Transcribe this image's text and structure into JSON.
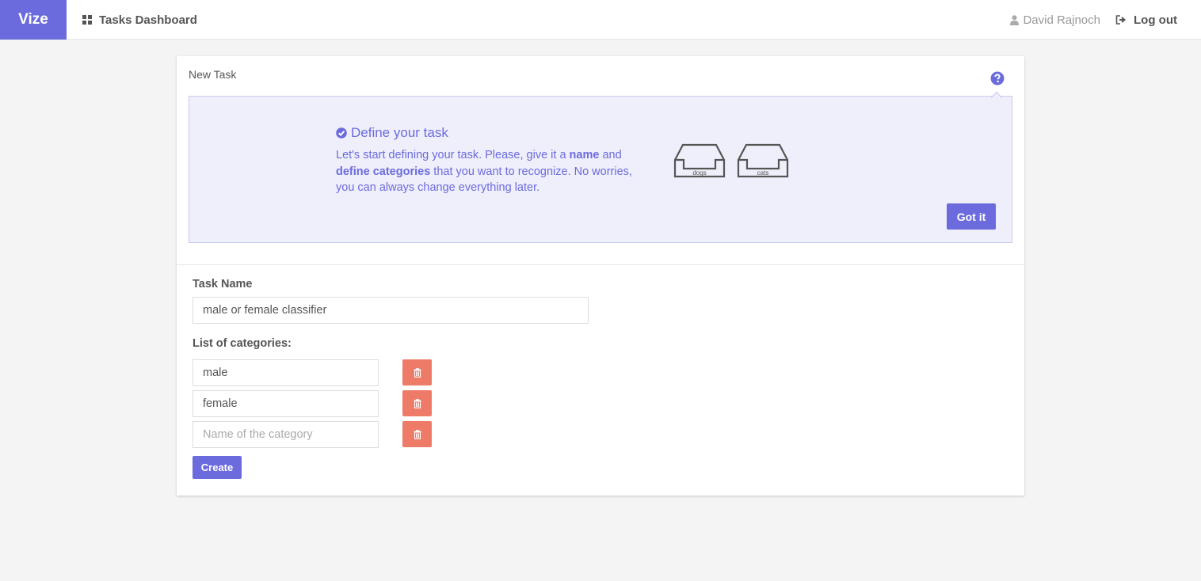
{
  "navbar": {
    "brand": "Vize",
    "dashboard_label": "Tasks Dashboard",
    "user_name": "David Rajnoch",
    "logout_label": "Log out"
  },
  "panel": {
    "title": "New Task",
    "help_icon": "question-circle-icon"
  },
  "info": {
    "title": "Define your task",
    "text_1": "Let's start defining your task. Please, give it a ",
    "text_bold_1": "name",
    "text_2": " and ",
    "text_bold_2": "define categories",
    "text_3": " that you want to recognize. No worries, you can always change everything later.",
    "tray_labels": [
      "dogs",
      "cats"
    ],
    "gotit_label": "Got it"
  },
  "form": {
    "task_name_label": "Task Name",
    "task_name_value": "male or female classifier",
    "categories_label": "List of categories:",
    "categories": [
      {
        "value": "male",
        "placeholder": "Name of the category"
      },
      {
        "value": "female",
        "placeholder": "Name of the category"
      },
      {
        "value": "",
        "placeholder": "Name of the category"
      }
    ],
    "create_label": "Create"
  },
  "colors": {
    "accent": "#6b6bde",
    "danger": "#ee7b68",
    "info_bg": "#efeffb"
  }
}
